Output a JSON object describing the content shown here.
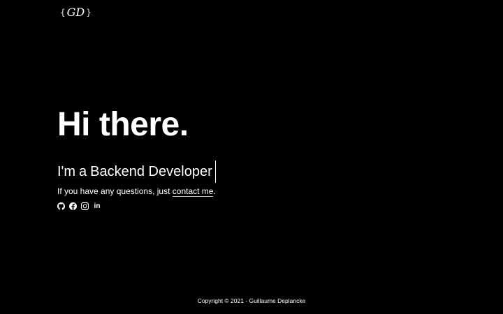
{
  "logo": {
    "left_brace": "{",
    "initials": "GD",
    "right_brace": "}"
  },
  "hero": {
    "title": "Hi there.",
    "role_prefix": "I'm",
    "role_article": "a",
    "role_text": "Backend Developer"
  },
  "contact": {
    "text_before": "If you have any questions, just ",
    "link_label": "contact me",
    "text_after": "."
  },
  "socials": [
    {
      "icon": "github-icon"
    },
    {
      "icon": "facebook-icon"
    },
    {
      "icon": "instagram-icon"
    },
    {
      "icon": "linkedin-icon",
      "label": "in"
    }
  ],
  "footer": {
    "copyright": "Copyright © 2021 - Guillaume Deplancke"
  },
  "colors": {
    "background": "#000000",
    "text": "#ffffff"
  }
}
